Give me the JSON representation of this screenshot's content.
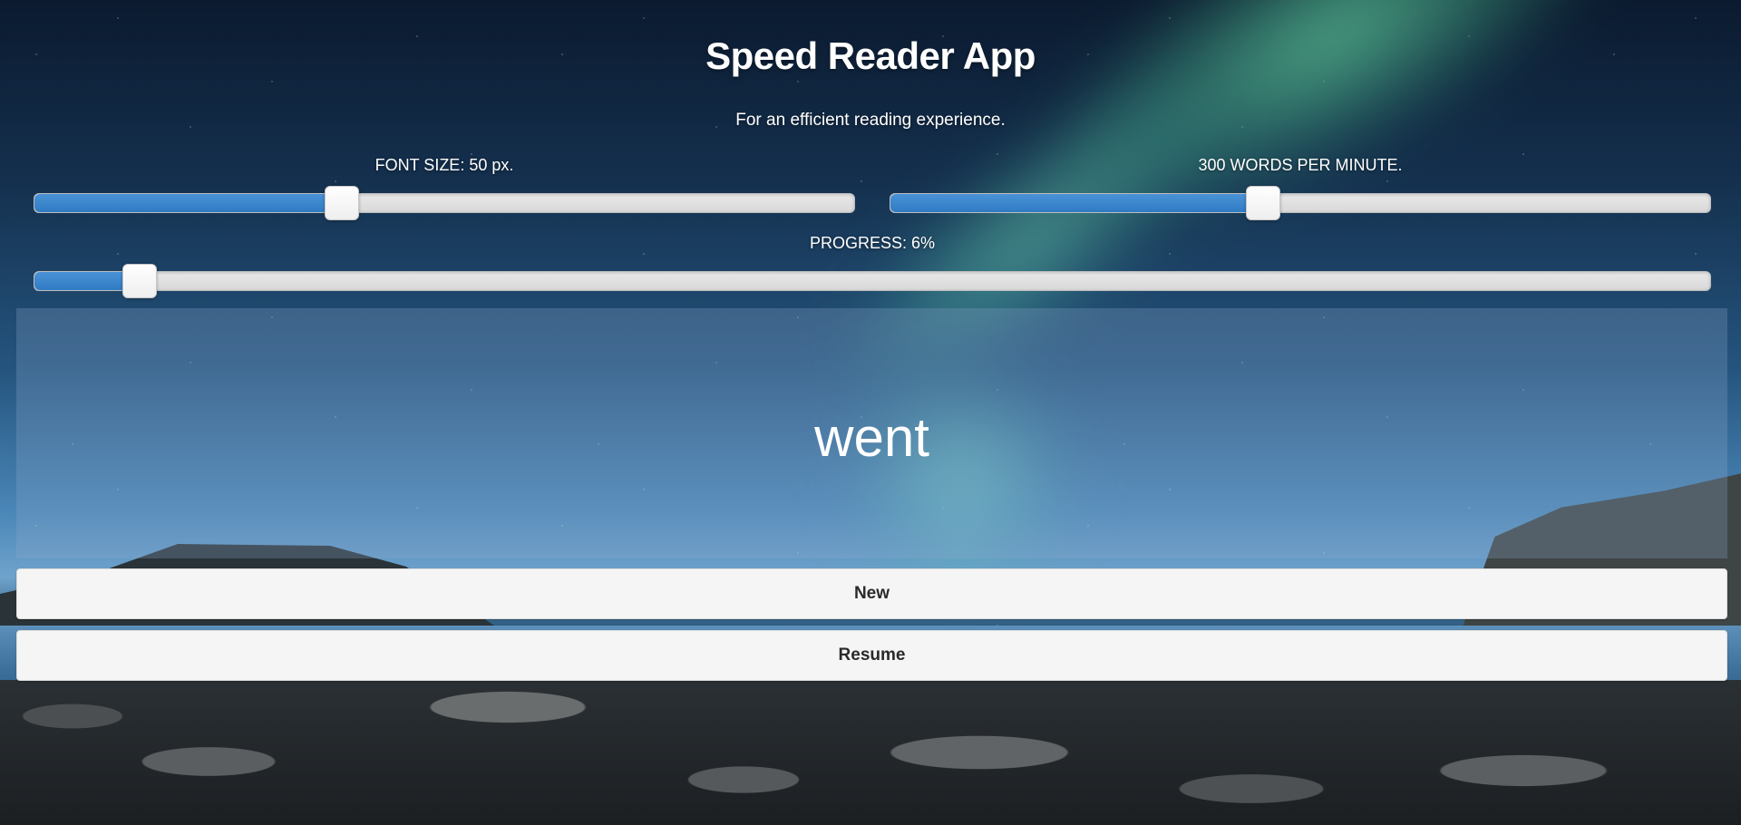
{
  "header": {
    "title": "Speed Reader App",
    "subtitle": "For an efficient reading experience."
  },
  "controls": {
    "font_size": {
      "label": "FONT SIZE: 50 px.",
      "fraction": 0.375
    },
    "speed": {
      "label": "300 WORDS PER MINUTE.",
      "fraction": 0.455
    },
    "progress": {
      "label": "PROGRESS: 6%",
      "fraction": 0.063
    }
  },
  "reader": {
    "current_word": "went"
  },
  "buttons": {
    "new_label": "New",
    "resume_label": "Resume"
  },
  "colors": {
    "slider_fill": "#2f7bc4",
    "button_bg": "#f5f5f5"
  }
}
